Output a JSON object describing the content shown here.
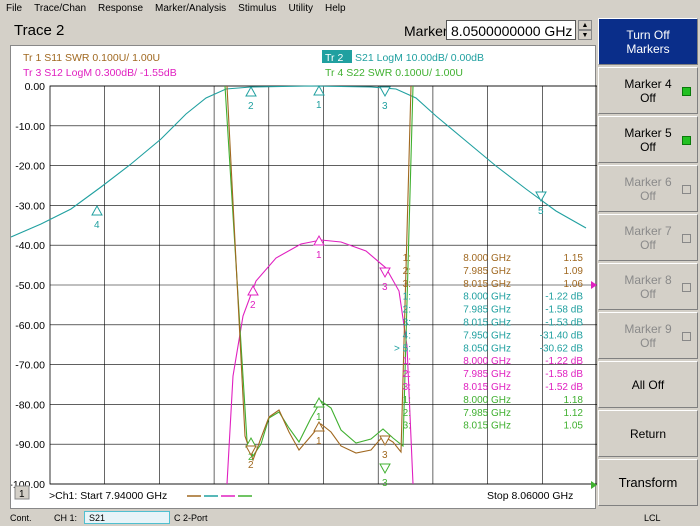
{
  "menu": [
    "File",
    "Trace/Chan",
    "Response",
    "Marker/Analysis",
    "Stimulus",
    "Utility",
    "Help"
  ],
  "header": {
    "trace_title": "Trace 2",
    "marker_label": "Marker 5",
    "marker_freq": "8.0500000000 GHz"
  },
  "trace_legend": [
    {
      "label": "Tr  1  S11 SWR 0.100U/  1.00U",
      "color": "#a06820"
    },
    {
      "label": "Tr  3  S12 LogM 0.300dB/  -1.55dB",
      "color": "#e020c0"
    },
    {
      "tag": "Tr  2",
      "label": "S21 LogM 10.00dB/  0.00dB",
      "color": "#20a0a0"
    },
    {
      "label": "Tr  4  S22 SWR 0.100U/  1.00U",
      "color": "#40b030"
    }
  ],
  "y_ticks": [
    "0.00",
    "-10.00",
    "-20.00",
    "-30.00",
    "-40.00",
    "-50.00",
    "-60.00",
    "-70.00",
    "-80.00",
    "-90.00",
    "-100.00"
  ],
  "marker_table": [
    {
      "n": "1:",
      "f": "8.000 GHz",
      "v": "1.15",
      "c": "#a06820"
    },
    {
      "n": "2:",
      "f": "7.985 GHz",
      "v": "1.09",
      "c": "#a06820"
    },
    {
      "n": "3:",
      "f": "8.015 GHz",
      "v": "1.06",
      "c": "#a06820"
    },
    {
      "n": "1:",
      "f": "8.000 GHz",
      "v": "-1.22 dB",
      "c": "#20a0a0"
    },
    {
      "n": "2:",
      "f": "7.985 GHz",
      "v": "-1.58 dB",
      "c": "#20a0a0"
    },
    {
      "n": "3:",
      "f": "8.015 GHz",
      "v": "-1.53 dB",
      "c": "#20a0a0"
    },
    {
      "n": "4:",
      "f": "7.950 GHz",
      "v": "-31.40 dB",
      "c": "#20a0a0"
    },
    {
      "n": "> 5:",
      "f": "8.050 GHz",
      "v": "-30.62 dB",
      "c": "#20a0a0"
    },
    {
      "n": "1:",
      "f": "8.000 GHz",
      "v": "-1.22 dB",
      "c": "#e020c0"
    },
    {
      "n": "2:",
      "f": "7.985 GHz",
      "v": "-1.58 dB",
      "c": "#e020c0"
    },
    {
      "n": "3:",
      "f": "8.015 GHz",
      "v": "-1.52 dB",
      "c": "#e020c0"
    },
    {
      "n": "1:",
      "f": "8.000 GHz",
      "v": "1.18",
      "c": "#40b030"
    },
    {
      "n": "2:",
      "f": "7.985 GHz",
      "v": "1.12",
      "c": "#40b030"
    },
    {
      "n": "3:",
      "f": "8.015 GHz",
      "v": "1.05",
      "c": "#40b030"
    }
  ],
  "footer": {
    "channel_num": "1",
    "start": ">Ch1: Start  7.94000 GHz",
    "stop": "Stop  8.06000 GHz"
  },
  "softkeys": [
    {
      "l1": "Turn Off",
      "l2": "Markers",
      "state": "active"
    },
    {
      "l1": "Marker 4",
      "l2": "Off",
      "state": "normal",
      "ind": "on"
    },
    {
      "l1": "Marker 5",
      "l2": "Off",
      "state": "normal",
      "ind": "on"
    },
    {
      "l1": "Marker 6",
      "l2": "Off",
      "state": "disabled",
      "ind": "off"
    },
    {
      "l1": "Marker 7",
      "l2": "Off",
      "state": "disabled",
      "ind": "off"
    },
    {
      "l1": "Marker 8",
      "l2": "Off",
      "state": "disabled",
      "ind": "off"
    },
    {
      "l1": "Marker 9",
      "l2": "Off",
      "state": "disabled",
      "ind": "off"
    },
    {
      "l1": "All Off",
      "l2": "",
      "state": "normal"
    },
    {
      "l1": "Return",
      "l2": "",
      "state": "normal"
    },
    {
      "l1": "Transform",
      "l2": "",
      "state": "normal"
    }
  ],
  "status": {
    "mode": "Cont.",
    "channel": "CH 1:",
    "param": "S21",
    "cal": "C  2-Port",
    "lcl": "LCL"
  },
  "colors": {
    "s11": "#a06820",
    "s21": "#20a0a0",
    "s12": "#e020c0",
    "s22": "#40b030",
    "active": "#0a2e8a"
  }
}
